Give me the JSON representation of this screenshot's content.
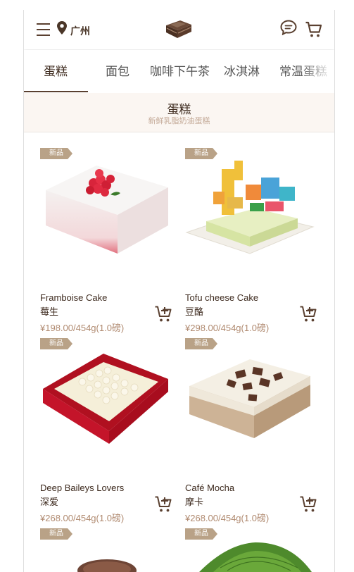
{
  "header": {
    "city": "广州",
    "icons": {
      "menu": "hamburger-menu-icon",
      "location": "location-pin-icon",
      "logo": "cake-logo-icon",
      "message": "message-bubble-icon",
      "cart": "shopping-cart-icon"
    },
    "accent_color": "#5a4030"
  },
  "tabs": [
    {
      "label": "蛋糕",
      "active": true
    },
    {
      "label": "面包",
      "active": false
    },
    {
      "label": "咖啡下午茶",
      "active": false
    },
    {
      "label": "冰淇淋",
      "active": false
    },
    {
      "label": "常温蛋糕",
      "active": false
    }
  ],
  "section": {
    "title": "蛋糕",
    "subtitle": "新鲜乳脂奶油蛋糕"
  },
  "products": [
    {
      "badge": "新品",
      "name_en": "Framboise Cake",
      "name_cn": "莓生",
      "price": "¥198.00/454g(1.0磅)"
    },
    {
      "badge": "新品",
      "name_en": "Tofu cheese Cake",
      "name_cn": "豆酪",
      "price": "¥298.00/454g(1.0磅)"
    },
    {
      "badge": "新品",
      "name_en": "Deep Baileys Lovers",
      "name_cn": "深爱",
      "price": "¥268.00/454g(1.0磅)"
    },
    {
      "badge": "新品",
      "name_en": "Café Mocha",
      "name_cn": "摩卡",
      "price": "¥268.00/454g(1.0磅)"
    },
    {
      "badge": "新品"
    },
    {
      "badge": "新品"
    }
  ]
}
